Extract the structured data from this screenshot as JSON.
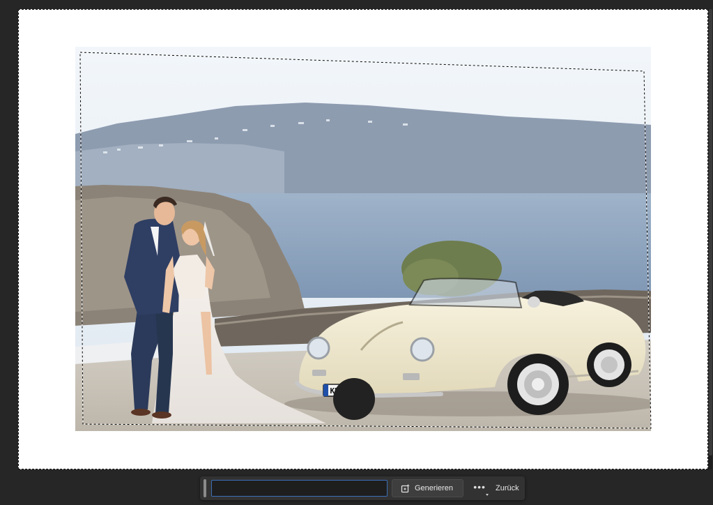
{
  "taskbar": {
    "prompt_value": "",
    "generate_label": "Generieren",
    "generate_icon": "generative-fill-icon",
    "more_icon": "more-options-icon",
    "back_label": "Zurück"
  },
  "photo": {
    "license_plate": "KNT-6816"
  },
  "colors": {
    "workspace_bg": "#262626",
    "canvas_bg": "#ffffff",
    "taskbar_bg": "#323232",
    "input_border": "#3b6fb6",
    "car_body": "#efe8cf"
  }
}
